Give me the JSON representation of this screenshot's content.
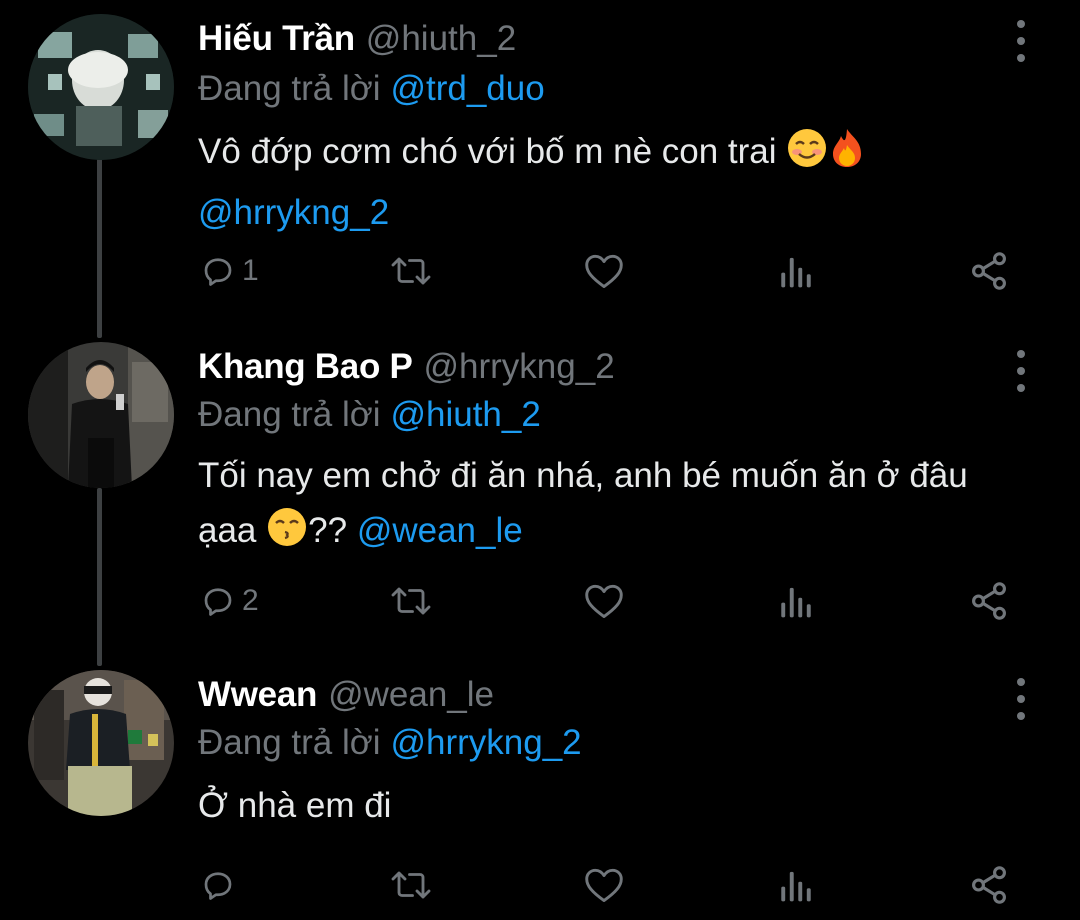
{
  "colors": {
    "background": "#000000",
    "text": "#e7e9ea",
    "muted": "#71767b",
    "link": "#1d9bf0",
    "thread_line": "#3d4042"
  },
  "tweets": [
    {
      "display_name": "Hiếu Trần",
      "handle": "@hiuth_2",
      "reply_prefix": "Đang trả lời",
      "reply_to": "@trd_duo",
      "text_line1": "Vô đớp cơm chó với bố m nè con trai",
      "text_emojis": [
        "smiling-face-emoji",
        "fire-emoji"
      ],
      "text_mention": "@hrrykng_2",
      "reply_count": "1",
      "icons": [
        "reply-icon",
        "retweet-icon",
        "like-icon",
        "views-icon",
        "share-icon"
      ]
    },
    {
      "display_name": "Khang Bao P",
      "handle": "@hrrykng_2",
      "reply_prefix": "Đang trả lời",
      "reply_to": "@hiuth_2",
      "text_line1": "Tối nay em chở đi ăn nhá, anh bé muốn ăn ở đâu",
      "text_line2_start": "ạaa",
      "text_emoji": "kissing-face-emoji",
      "text_line2_end": "??",
      "text_mention": "@wean_le",
      "reply_count": "2",
      "icons": [
        "reply-icon",
        "retweet-icon",
        "like-icon",
        "views-icon",
        "share-icon"
      ]
    },
    {
      "display_name": "Wwean",
      "handle": "@wean_le",
      "reply_prefix": "Đang trả lời",
      "reply_to": "@hrrykng_2",
      "text_line1": "Ở nhà em đi",
      "reply_count": "",
      "icons": [
        "reply-icon",
        "retweet-icon",
        "like-icon",
        "views-icon",
        "share-icon"
      ]
    }
  ]
}
